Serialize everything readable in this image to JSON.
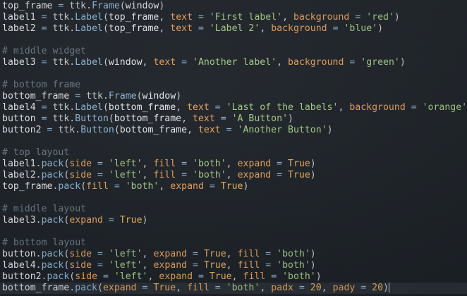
{
  "editor": {
    "lines": [
      {
        "type": "code",
        "tokens": [
          {
            "t": "top_frame",
            "c": "ident"
          },
          {
            "t": " = ",
            "c": "op"
          },
          {
            "t": "ttk",
            "c": "mod"
          },
          {
            "t": ".",
            "c": "punc"
          },
          {
            "t": "Frame",
            "c": "fn"
          },
          {
            "t": "(",
            "c": "punc"
          },
          {
            "t": "window",
            "c": "ident"
          },
          {
            "t": ")",
            "c": "punc"
          }
        ]
      },
      {
        "type": "code",
        "tokens": [
          {
            "t": "label1",
            "c": "ident"
          },
          {
            "t": " = ",
            "c": "op"
          },
          {
            "t": "ttk",
            "c": "mod"
          },
          {
            "t": ".",
            "c": "punc"
          },
          {
            "t": "Label",
            "c": "fn"
          },
          {
            "t": "(",
            "c": "punc"
          },
          {
            "t": "top_frame",
            "c": "ident"
          },
          {
            "t": ", ",
            "c": "punc"
          },
          {
            "t": "text",
            "c": "arg"
          },
          {
            "t": " = ",
            "c": "op"
          },
          {
            "t": "'First label'",
            "c": "str"
          },
          {
            "t": ", ",
            "c": "punc"
          },
          {
            "t": "background",
            "c": "arg"
          },
          {
            "t": " = ",
            "c": "op"
          },
          {
            "t": "'red'",
            "c": "str"
          },
          {
            "t": ")",
            "c": "punc"
          }
        ]
      },
      {
        "type": "code",
        "tokens": [
          {
            "t": "label2",
            "c": "ident"
          },
          {
            "t": " = ",
            "c": "op"
          },
          {
            "t": "ttk",
            "c": "mod"
          },
          {
            "t": ".",
            "c": "punc"
          },
          {
            "t": "Label",
            "c": "fn"
          },
          {
            "t": "(",
            "c": "punc"
          },
          {
            "t": "top_frame",
            "c": "ident"
          },
          {
            "t": ", ",
            "c": "punc"
          },
          {
            "t": "text",
            "c": "arg"
          },
          {
            "t": " = ",
            "c": "op"
          },
          {
            "t": "'Label 2'",
            "c": "str"
          },
          {
            "t": ", ",
            "c": "punc"
          },
          {
            "t": "background",
            "c": "arg"
          },
          {
            "t": " = ",
            "c": "op"
          },
          {
            "t": "'blue'",
            "c": "str"
          },
          {
            "t": ")",
            "c": "punc"
          }
        ]
      },
      {
        "type": "blank",
        "tokens": []
      },
      {
        "type": "comment",
        "tokens": [
          {
            "t": "# middle widget",
            "c": "cmt"
          }
        ]
      },
      {
        "type": "code",
        "tokens": [
          {
            "t": "label3",
            "c": "ident"
          },
          {
            "t": " = ",
            "c": "op"
          },
          {
            "t": "ttk",
            "c": "mod"
          },
          {
            "t": ".",
            "c": "punc"
          },
          {
            "t": "Label",
            "c": "fn"
          },
          {
            "t": "(",
            "c": "punc"
          },
          {
            "t": "window",
            "c": "ident"
          },
          {
            "t": ", ",
            "c": "punc"
          },
          {
            "t": "text",
            "c": "arg"
          },
          {
            "t": " = ",
            "c": "op"
          },
          {
            "t": "'Another label'",
            "c": "str"
          },
          {
            "t": ", ",
            "c": "punc"
          },
          {
            "t": "background",
            "c": "arg"
          },
          {
            "t": " = ",
            "c": "op"
          },
          {
            "t": "'green'",
            "c": "str"
          },
          {
            "t": ")",
            "c": "punc"
          }
        ]
      },
      {
        "type": "blank",
        "tokens": []
      },
      {
        "type": "comment",
        "tokens": [
          {
            "t": "# bottom frame",
            "c": "cmt"
          }
        ]
      },
      {
        "type": "code",
        "tokens": [
          {
            "t": "bottom_frame",
            "c": "ident"
          },
          {
            "t": " = ",
            "c": "op"
          },
          {
            "t": "ttk",
            "c": "mod"
          },
          {
            "t": ".",
            "c": "punc"
          },
          {
            "t": "Frame",
            "c": "fn"
          },
          {
            "t": "(",
            "c": "punc"
          },
          {
            "t": "window",
            "c": "ident"
          },
          {
            "t": ")",
            "c": "punc"
          }
        ]
      },
      {
        "type": "code",
        "tokens": [
          {
            "t": "label4",
            "c": "ident"
          },
          {
            "t": " = ",
            "c": "op"
          },
          {
            "t": "ttk",
            "c": "mod"
          },
          {
            "t": ".",
            "c": "punc"
          },
          {
            "t": "Label",
            "c": "fn"
          },
          {
            "t": "(",
            "c": "punc"
          },
          {
            "t": "bottom_frame",
            "c": "ident"
          },
          {
            "t": ", ",
            "c": "punc"
          },
          {
            "t": "text",
            "c": "arg"
          },
          {
            "t": " = ",
            "c": "op"
          },
          {
            "t": "'Last of the labels'",
            "c": "str"
          },
          {
            "t": ", ",
            "c": "punc"
          },
          {
            "t": "background",
            "c": "arg"
          },
          {
            "t": " = ",
            "c": "op"
          },
          {
            "t": "'orange'",
            "c": "str"
          },
          {
            "t": ")",
            "c": "punc"
          }
        ]
      },
      {
        "type": "code",
        "tokens": [
          {
            "t": "button",
            "c": "ident"
          },
          {
            "t": " = ",
            "c": "op"
          },
          {
            "t": "ttk",
            "c": "mod"
          },
          {
            "t": ".",
            "c": "punc"
          },
          {
            "t": "Button",
            "c": "fn"
          },
          {
            "t": "(",
            "c": "punc"
          },
          {
            "t": "bottom_frame",
            "c": "ident"
          },
          {
            "t": ", ",
            "c": "punc"
          },
          {
            "t": "text",
            "c": "arg"
          },
          {
            "t": " = ",
            "c": "op"
          },
          {
            "t": "'A Button'",
            "c": "str"
          },
          {
            "t": ")",
            "c": "punc"
          }
        ]
      },
      {
        "type": "code",
        "tokens": [
          {
            "t": "button2",
            "c": "ident"
          },
          {
            "t": " = ",
            "c": "op"
          },
          {
            "t": "ttk",
            "c": "mod"
          },
          {
            "t": ".",
            "c": "punc"
          },
          {
            "t": "Button",
            "c": "fn"
          },
          {
            "t": "(",
            "c": "punc"
          },
          {
            "t": "bottom_frame",
            "c": "ident"
          },
          {
            "t": ", ",
            "c": "punc"
          },
          {
            "t": "text",
            "c": "arg"
          },
          {
            "t": " = ",
            "c": "op"
          },
          {
            "t": "'Another Button'",
            "c": "str"
          },
          {
            "t": ")",
            "c": "punc"
          }
        ]
      },
      {
        "type": "blank",
        "tokens": []
      },
      {
        "type": "comment",
        "tokens": [
          {
            "t": "# top layout",
            "c": "cmt"
          }
        ]
      },
      {
        "type": "code",
        "tokens": [
          {
            "t": "label1",
            "c": "ident"
          },
          {
            "t": ".",
            "c": "punc"
          },
          {
            "t": "pack",
            "c": "fn"
          },
          {
            "t": "(",
            "c": "punc"
          },
          {
            "t": "side",
            "c": "arg"
          },
          {
            "t": " = ",
            "c": "op"
          },
          {
            "t": "'left'",
            "c": "str"
          },
          {
            "t": ", ",
            "c": "punc"
          },
          {
            "t": "fill",
            "c": "arg"
          },
          {
            "t": " = ",
            "c": "op"
          },
          {
            "t": "'both'",
            "c": "str"
          },
          {
            "t": ", ",
            "c": "punc"
          },
          {
            "t": "expand",
            "c": "arg"
          },
          {
            "t": " = ",
            "c": "op"
          },
          {
            "t": "True",
            "c": "const"
          },
          {
            "t": ")",
            "c": "punc"
          }
        ]
      },
      {
        "type": "code",
        "tokens": [
          {
            "t": "label2",
            "c": "ident"
          },
          {
            "t": ".",
            "c": "punc"
          },
          {
            "t": "pack",
            "c": "fn"
          },
          {
            "t": "(",
            "c": "punc"
          },
          {
            "t": "side",
            "c": "arg"
          },
          {
            "t": " = ",
            "c": "op"
          },
          {
            "t": "'left'",
            "c": "str"
          },
          {
            "t": ", ",
            "c": "punc"
          },
          {
            "t": "fill",
            "c": "arg"
          },
          {
            "t": " = ",
            "c": "op"
          },
          {
            "t": "'both'",
            "c": "str"
          },
          {
            "t": ", ",
            "c": "punc"
          },
          {
            "t": "expand",
            "c": "arg"
          },
          {
            "t": " = ",
            "c": "op"
          },
          {
            "t": "True",
            "c": "const"
          },
          {
            "t": ")",
            "c": "punc"
          }
        ]
      },
      {
        "type": "code",
        "tokens": [
          {
            "t": "top_frame",
            "c": "ident"
          },
          {
            "t": ".",
            "c": "punc"
          },
          {
            "t": "pack",
            "c": "fn"
          },
          {
            "t": "(",
            "c": "punc"
          },
          {
            "t": "fill",
            "c": "arg"
          },
          {
            "t": " = ",
            "c": "op"
          },
          {
            "t": "'both'",
            "c": "str"
          },
          {
            "t": ", ",
            "c": "punc"
          },
          {
            "t": "expand",
            "c": "arg"
          },
          {
            "t": " = ",
            "c": "op"
          },
          {
            "t": "True",
            "c": "const"
          },
          {
            "t": ")",
            "c": "punc"
          }
        ]
      },
      {
        "type": "blank",
        "tokens": []
      },
      {
        "type": "comment",
        "tokens": [
          {
            "t": "# middle layout",
            "c": "cmt"
          }
        ]
      },
      {
        "type": "code",
        "tokens": [
          {
            "t": "label3",
            "c": "ident"
          },
          {
            "t": ".",
            "c": "punc"
          },
          {
            "t": "pack",
            "c": "fn"
          },
          {
            "t": "(",
            "c": "punc"
          },
          {
            "t": "expand",
            "c": "arg"
          },
          {
            "t": " = ",
            "c": "op"
          },
          {
            "t": "True",
            "c": "const"
          },
          {
            "t": ")",
            "c": "punc"
          }
        ]
      },
      {
        "type": "blank",
        "tokens": []
      },
      {
        "type": "comment",
        "tokens": [
          {
            "t": "# bottom layout",
            "c": "cmt"
          }
        ]
      },
      {
        "type": "code",
        "tokens": [
          {
            "t": "button",
            "c": "ident"
          },
          {
            "t": ".",
            "c": "punc"
          },
          {
            "t": "pack",
            "c": "fn"
          },
          {
            "t": "(",
            "c": "punc"
          },
          {
            "t": "side",
            "c": "arg"
          },
          {
            "t": " = ",
            "c": "op"
          },
          {
            "t": "'left'",
            "c": "str"
          },
          {
            "t": ", ",
            "c": "punc"
          },
          {
            "t": "expand",
            "c": "arg"
          },
          {
            "t": " = ",
            "c": "op"
          },
          {
            "t": "True",
            "c": "const"
          },
          {
            "t": ", ",
            "c": "punc"
          },
          {
            "t": "fill",
            "c": "arg"
          },
          {
            "t": " = ",
            "c": "op"
          },
          {
            "t": "'both'",
            "c": "str"
          },
          {
            "t": ")",
            "c": "punc"
          }
        ]
      },
      {
        "type": "code",
        "tokens": [
          {
            "t": "label4",
            "c": "ident"
          },
          {
            "t": ".",
            "c": "punc"
          },
          {
            "t": "pack",
            "c": "fn"
          },
          {
            "t": "(",
            "c": "punc"
          },
          {
            "t": "side",
            "c": "arg"
          },
          {
            "t": " = ",
            "c": "op"
          },
          {
            "t": "'left'",
            "c": "str"
          },
          {
            "t": ", ",
            "c": "punc"
          },
          {
            "t": "expand",
            "c": "arg"
          },
          {
            "t": " = ",
            "c": "op"
          },
          {
            "t": "True",
            "c": "const"
          },
          {
            "t": ", ",
            "c": "punc"
          },
          {
            "t": "fill",
            "c": "arg"
          },
          {
            "t": " = ",
            "c": "op"
          },
          {
            "t": "'both'",
            "c": "str"
          },
          {
            "t": ")",
            "c": "punc"
          }
        ]
      },
      {
        "type": "code",
        "tokens": [
          {
            "t": "button2",
            "c": "ident"
          },
          {
            "t": ".",
            "c": "punc"
          },
          {
            "t": "pack",
            "c": "fn"
          },
          {
            "t": "(",
            "c": "punc"
          },
          {
            "t": "side",
            "c": "arg"
          },
          {
            "t": " = ",
            "c": "op"
          },
          {
            "t": "'left'",
            "c": "str"
          },
          {
            "t": ", ",
            "c": "punc"
          },
          {
            "t": "expand",
            "c": "arg"
          },
          {
            "t": " = ",
            "c": "op"
          },
          {
            "t": "True",
            "c": "const"
          },
          {
            "t": ", ",
            "c": "punc"
          },
          {
            "t": "fill",
            "c": "arg"
          },
          {
            "t": " = ",
            "c": "op"
          },
          {
            "t": "'both'",
            "c": "str"
          },
          {
            "t": ")",
            "c": "punc"
          }
        ]
      },
      {
        "type": "code",
        "current": true,
        "tokens": [
          {
            "t": "bottom_frame",
            "c": "ident"
          },
          {
            "t": ".",
            "c": "punc"
          },
          {
            "t": "pack",
            "c": "fn"
          },
          {
            "t": "(",
            "c": "punc"
          },
          {
            "t": "expand",
            "c": "arg"
          },
          {
            "t": " = ",
            "c": "op"
          },
          {
            "t": "True",
            "c": "const"
          },
          {
            "t": ", ",
            "c": "punc"
          },
          {
            "t": "fill",
            "c": "arg"
          },
          {
            "t": " = ",
            "c": "op"
          },
          {
            "t": "'both'",
            "c": "str"
          },
          {
            "t": ", ",
            "c": "punc"
          },
          {
            "t": "padx",
            "c": "arg"
          },
          {
            "t": " = ",
            "c": "op"
          },
          {
            "t": "20",
            "c": "num"
          },
          {
            "t": ", ",
            "c": "punc"
          },
          {
            "t": "pady",
            "c": "arg"
          },
          {
            "t": " = ",
            "c": "op"
          },
          {
            "t": "20",
            "c": "num"
          },
          {
            "t": ")",
            "c": "punc"
          }
        ]
      }
    ]
  }
}
